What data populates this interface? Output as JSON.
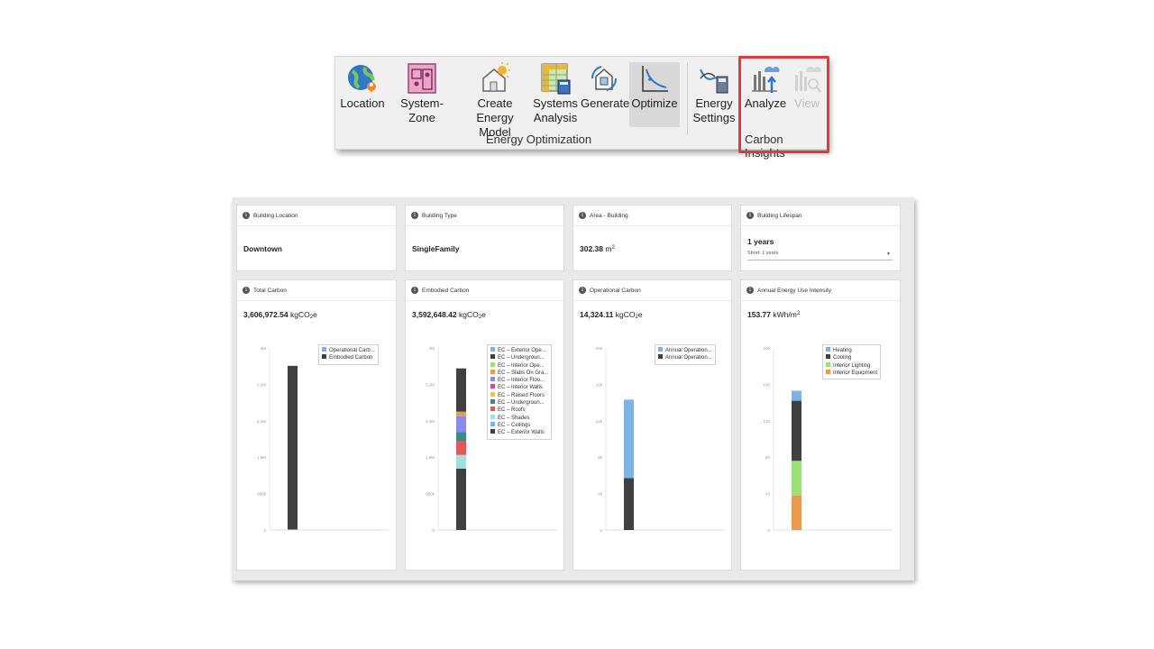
{
  "ribbon": {
    "buttons": [
      {
        "id": "location",
        "label": "Location"
      },
      {
        "id": "system_zone",
        "label": "System-Zone"
      },
      {
        "id": "create_energy_model",
        "label": "Create Energy Model"
      },
      {
        "id": "systems_analysis",
        "label": "Systems Analysis"
      },
      {
        "id": "generate",
        "label": "Generate"
      },
      {
        "id": "optimize",
        "label": "Optimize"
      },
      {
        "id": "energy_settings",
        "label": "Energy Settings"
      },
      {
        "id": "analyze",
        "label": "Analyze"
      },
      {
        "id": "view",
        "label": "View"
      }
    ],
    "labels": {
      "location": "Location",
      "system_zone": "System-Zone",
      "create_line1": "Create",
      "create_line2": "Energy Model",
      "systems_line1": "Systems",
      "systems_line2": "Analysis",
      "generate": "Generate",
      "optimize": "Optimize",
      "energy_line1": "Energy",
      "energy_line2": "Settings",
      "analyze": "Analyze",
      "view": "View"
    },
    "groups": {
      "energy_optimization": "Energy Optimization",
      "carbon_insights": "Carbon Insights"
    },
    "icons": [
      "globe-pin-icon",
      "system-zone-icon",
      "house-sun-icon",
      "spreadsheet-calc-icon",
      "generate-icon",
      "optimize-curve-icon",
      "energy-settings-icon",
      "analyze-cloud-icon",
      "view-chart-icon"
    ],
    "highlight_color": "#e03a3a"
  },
  "cards": {
    "building_location": {
      "title": "Building Location",
      "value": "Downtown"
    },
    "building_type": {
      "title": "Building Type",
      "value": "SingleFamily"
    },
    "area": {
      "title": "Area - Building",
      "value": "302.38",
      "unit": "m"
    },
    "lifespan": {
      "title": "Building Lifespan",
      "value": "1 years",
      "select": "Short: 1 years"
    },
    "total_carbon": {
      "title": "Total Carbon",
      "value": "3,606,972.54",
      "unit_pre": "kgCO",
      "unit_sub": "2",
      "unit_post": "e"
    },
    "embodied_carbon": {
      "title": "Embodied Carbon",
      "value": "3,592,648.42",
      "unit_pre": "kgCO",
      "unit_sub": "2",
      "unit_post": "e"
    },
    "operational_carbon": {
      "title": "Operational Carbon",
      "value": "14,324.11",
      "unit_pre": "kgCO",
      "unit_sub": "2",
      "unit_post": "e"
    },
    "eui": {
      "title": "Annual Energy Use Intensity",
      "value": "153.77",
      "unit": "kWh/m"
    }
  },
  "chart_data": [
    {
      "type": "bar",
      "title": "Total Carbon",
      "yticks": [
        "4M",
        "3.2M",
        "2.4M",
        "1.6M",
        "800k",
        "0"
      ],
      "ylim": [
        0,
        4000000
      ],
      "series": [
        {
          "name": "Operational Carb...",
          "color": "#7fb2e5",
          "values": [
            14324
          ]
        },
        {
          "name": "Embodied Carbon",
          "color": "#404040",
          "values": [
            3592648
          ]
        }
      ]
    },
    {
      "type": "bar",
      "title": "Embodied Carbon",
      "yticks": [
        "4M",
        "3.2M",
        "2.4M",
        "1.6M",
        "800k",
        "0"
      ],
      "ylim": [
        0,
        4000000
      ],
      "series": [
        {
          "name": "EC – Exterior Walls",
          "color": "#404040",
          "values": [
            1350000
          ]
        },
        {
          "name": "EC – Ceilings",
          "color": "#7fb2e5",
          "values": [
            0
          ]
        },
        {
          "name": "EC – Shades",
          "color": "#9ee0dc",
          "values": [
            300000
          ]
        },
        {
          "name": "EC – Roofs",
          "color": "#e05858",
          "values": [
            300000
          ]
        },
        {
          "name": "EC – Undergroun...",
          "color": "#3e8a86",
          "values": [
            200000
          ]
        },
        {
          "name": "EC – Raised Floors",
          "color": "#e0c84a",
          "values": [
            0
          ]
        },
        {
          "name": "EC – Interior Walls",
          "color": "#d04a90",
          "values": [
            0
          ]
        },
        {
          "name": "EC – Interior Floo...",
          "color": "#8a8ae8",
          "values": [
            350000
          ]
        },
        {
          "name": "EC – Slabs On Gra...",
          "color": "#e89a50",
          "values": [
            100000
          ]
        },
        {
          "name": "EC – Interior Ope...",
          "color": "#9de07a",
          "values": [
            0
          ]
        },
        {
          "name": "EC – Undergroun...",
          "color": "#404040",
          "values": [
            950000
          ]
        },
        {
          "name": "EC – Exterior Ope...",
          "color": "#7fb2e5",
          "values": [
            0
          ]
        }
      ],
      "legend_order": [
        "EC – Exterior Ope...",
        "EC – Undergroun...",
        "EC – Interior Ope...",
        "EC – Slabs On Gra...",
        "EC – Interior Floo...",
        "EC – Interior Walls",
        "EC – Raised Floors",
        "EC – Undergroun...",
        "EC – Roofs",
        "EC – Shades",
        "EC – Ceilings",
        "EC – Exterior Walls"
      ],
      "legend_colors": [
        "#7fb2e5",
        "#404040",
        "#9de07a",
        "#e89a50",
        "#8a8ae8",
        "#d04a90",
        "#e0c84a",
        "#3e8a86",
        "#e05858",
        "#9ee0dc",
        "#7fb2e5",
        "#404040"
      ]
    },
    {
      "type": "bar",
      "title": "Operational Carbon",
      "yticks": [
        "20k",
        "16k",
        "12k",
        "8k",
        "4k",
        "0"
      ],
      "ylim": [
        0,
        20000
      ],
      "series": [
        {
          "name": "Annual Operation...",
          "color": "#404040",
          "values": [
            5700
          ]
        },
        {
          "name": "Annual Operation...",
          "color": "#7fb2e5",
          "values": [
            8624
          ]
        }
      ],
      "legend_order": [
        "Annual Operation...",
        "Annual Operation..."
      ],
      "legend_colors": [
        "#7fb2e5",
        "#404040"
      ]
    },
    {
      "type": "bar",
      "title": "Annual Energy Use Intensity",
      "yticks": [
        "200",
        "160",
        "120",
        "80",
        "40",
        "0"
      ],
      "ylim": [
        0,
        200
      ],
      "series": [
        {
          "name": "Interior Equipment",
          "color": "#e89a50",
          "values": [
            38
          ]
        },
        {
          "name": "Interior Lighting",
          "color": "#9de07a",
          "values": [
            38
          ]
        },
        {
          "name": "Cooling",
          "color": "#404040",
          "values": [
            66
          ]
        },
        {
          "name": "Heating",
          "color": "#7fb2e5",
          "values": [
            11
          ]
        }
      ],
      "legend_order": [
        "Heating",
        "Cooling",
        "Interior Lighting",
        "Interior Equipment"
      ],
      "legend_colors": [
        "#7fb2e5",
        "#404040",
        "#9de07a",
        "#e89a50"
      ]
    }
  ]
}
